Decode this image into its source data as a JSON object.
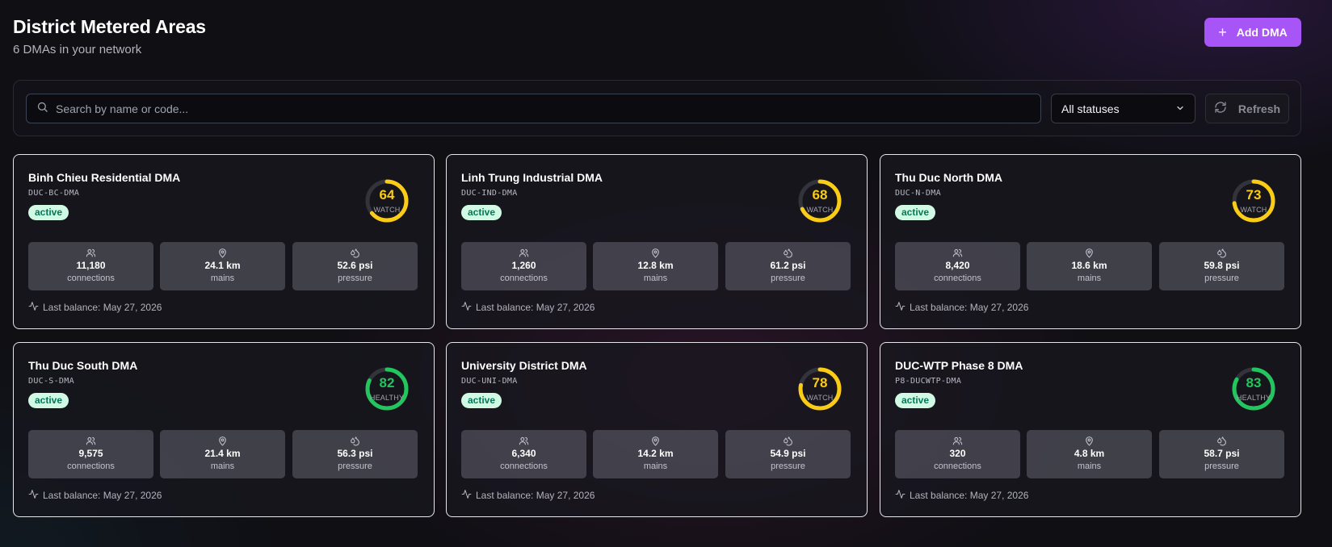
{
  "header": {
    "title": "District Metered Areas",
    "subtitle": "6 DMAs in your network",
    "add_label": "Add DMA"
  },
  "filters": {
    "search_placeholder": "Search by name or code...",
    "status_selected": "All statuses",
    "refresh_label": "Refresh"
  },
  "colors": {
    "accent": "#a855f7",
    "watch": "#facc15",
    "healthy": "#22c55e",
    "badge_bg": "#d1fae5",
    "badge_text": "#047857"
  },
  "stat_labels": {
    "connections": "connections",
    "mains": "mains",
    "pressure": "pressure"
  },
  "cards": [
    {
      "name": "Binh Chieu Residential DMA",
      "code": "DUC-BC-DMA",
      "status": "active",
      "score": "64",
      "score_label": "WATCH",
      "health": "watch",
      "connections": "11,180",
      "mains": "24.1 km",
      "pressure": "52.6 psi",
      "last_balance": "Last balance: May 27, 2026"
    },
    {
      "name": "Linh Trung Industrial DMA",
      "code": "DUC-IND-DMA",
      "status": "active",
      "score": "68",
      "score_label": "WATCH",
      "health": "watch",
      "connections": "1,260",
      "mains": "12.8 km",
      "pressure": "61.2 psi",
      "last_balance": "Last balance: May 27, 2026"
    },
    {
      "name": "Thu Duc North DMA",
      "code": "DUC-N-DMA",
      "status": "active",
      "score": "73",
      "score_label": "WATCH",
      "health": "watch",
      "connections": "8,420",
      "mains": "18.6 km",
      "pressure": "59.8 psi",
      "last_balance": "Last balance: May 27, 2026"
    },
    {
      "name": "Thu Duc South DMA",
      "code": "DUC-S-DMA",
      "status": "active",
      "score": "82",
      "score_label": "HEALTHY",
      "health": "healthy",
      "connections": "9,575",
      "mains": "21.4 km",
      "pressure": "56.3 psi",
      "last_balance": "Last balance: May 27, 2026"
    },
    {
      "name": "University District DMA",
      "code": "DUC-UNI-DMA",
      "status": "active",
      "score": "78",
      "score_label": "WATCH",
      "health": "watch",
      "connections": "6,340",
      "mains": "14.2 km",
      "pressure": "54.9 psi",
      "last_balance": "Last balance: May 27, 2026"
    },
    {
      "name": "DUC-WTP Phase 8 DMA",
      "code": "P8-DUCWTP-DMA",
      "status": "active",
      "score": "83",
      "score_label": "HEALTHY",
      "health": "healthy",
      "connections": "320",
      "mains": "4.8 km",
      "pressure": "58.7 psi",
      "last_balance": "Last balance: May 27, 2026"
    }
  ]
}
